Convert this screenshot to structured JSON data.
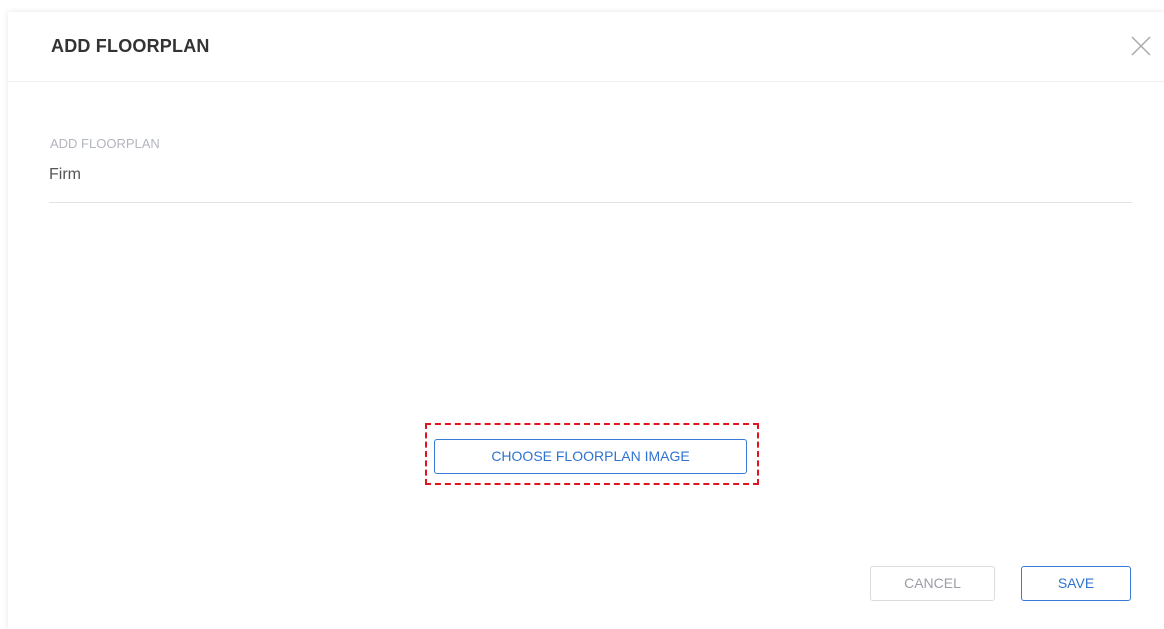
{
  "dialog": {
    "title": "ADD FLOORPLAN",
    "close_icon": "close-icon"
  },
  "form": {
    "name_label": "ADD FLOORPLAN",
    "name_value": "Firm"
  },
  "upload": {
    "choose_label": "CHOOSE FLOORPLAN IMAGE",
    "highlight_color": "#e0141e"
  },
  "footer": {
    "cancel_label": "CANCEL",
    "save_label": "SAVE"
  },
  "colors": {
    "accent": "#3a7bd5",
    "muted": "#9a9ea5"
  }
}
